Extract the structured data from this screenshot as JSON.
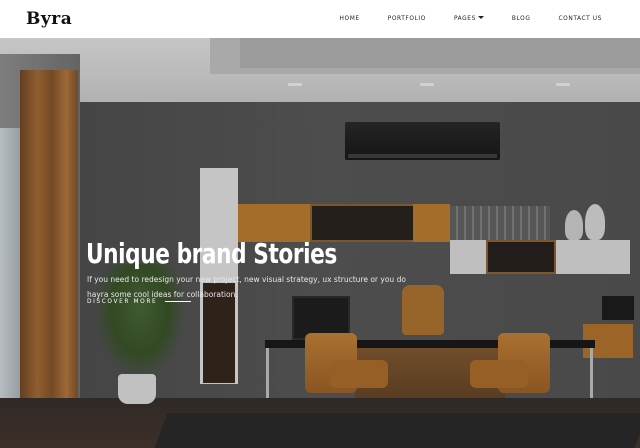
{
  "brand": {
    "logo": "Byra"
  },
  "nav": {
    "items": [
      {
        "label": "HOME"
      },
      {
        "label": "PORTFOLIO"
      },
      {
        "label": "PAGES",
        "dropdown": true
      },
      {
        "label": "BLOG"
      },
      {
        "label": "CONTACT US"
      }
    ]
  },
  "hero": {
    "title": "Unique brand Stories",
    "description": "If you need to redesign your new project, new visual strategy, ux structure or you do hayra some cool ideas for collaboration.",
    "cta_label": "DISCOVER MORE"
  },
  "colors": {
    "accent_wood": "#c88532",
    "text_on_hero": "#ffffff",
    "navbar_bg": "#ffffff"
  }
}
